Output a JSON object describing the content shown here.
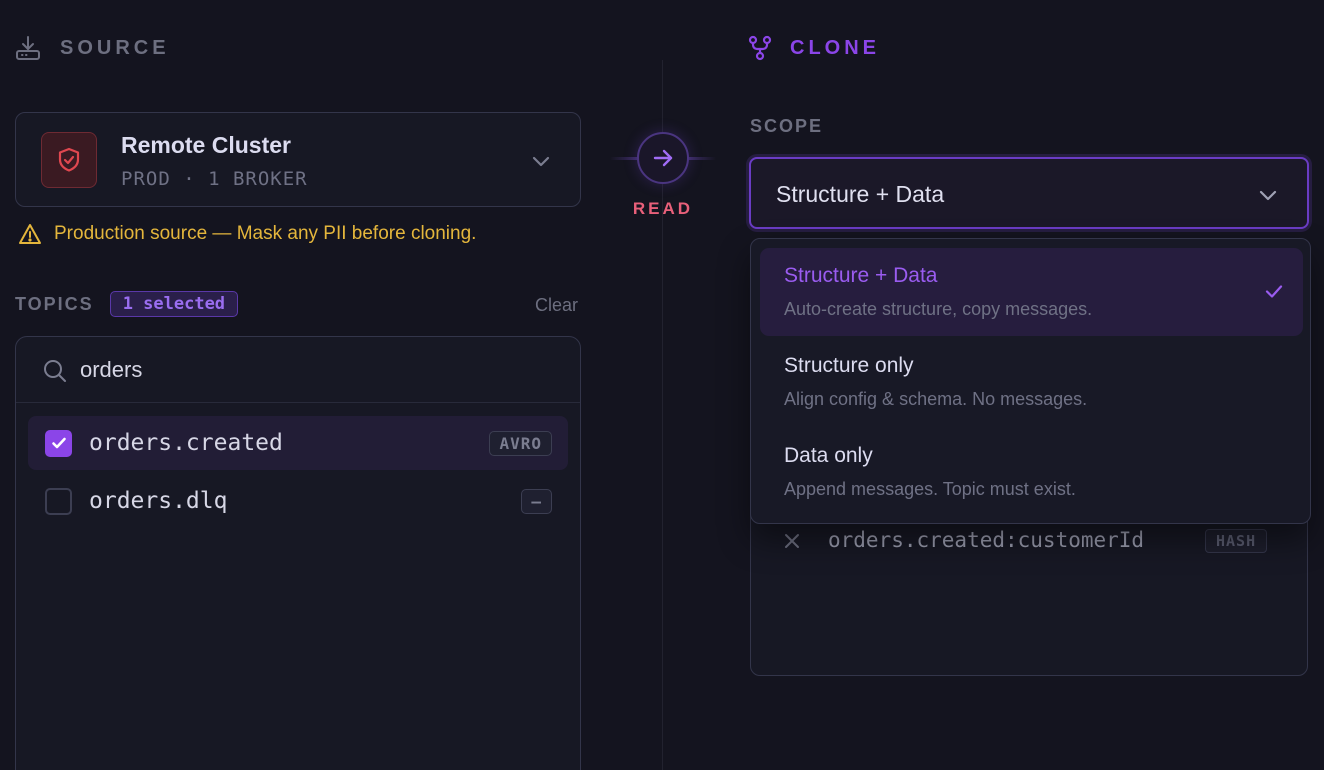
{
  "source": {
    "heading": "SOURCE",
    "icon": "download-tray-icon",
    "cluster": {
      "name": "Remote Cluster",
      "meta": "PROD · 1 BROKER",
      "icon": "shield-check-icon"
    },
    "warning": "Production source — Mask any PII before cloning.",
    "topics": {
      "heading": "TOPICS",
      "selected_badge": "1 selected",
      "clear_label": "Clear",
      "search_value": "orders",
      "items": [
        {
          "name": "orders.created",
          "tag": "AVRO",
          "checked": true
        },
        {
          "name": "orders.dlq",
          "tag": "—",
          "checked": false
        }
      ]
    }
  },
  "connector": {
    "label": "READ",
    "icon": "arrow-right-icon"
  },
  "clone": {
    "heading": "CLONE",
    "icon": "branch-icon",
    "scope": {
      "label": "SCOPE",
      "selected": "Structure + Data",
      "options": [
        {
          "title": "Structure + Data",
          "desc": "Auto-create structure, copy messages.",
          "active": true
        },
        {
          "title": "Structure only",
          "desc": "Align config & schema. No messages.",
          "active": false
        },
        {
          "title": "Data only",
          "desc": "Append messages. Topic must exist.",
          "active": false
        }
      ]
    },
    "masking": {
      "rules": [
        {
          "field": "orders.created:customerId",
          "method": "HASH"
        }
      ]
    }
  },
  "colors": {
    "background": "#14141f",
    "accent": "#8b45e8",
    "warning": "#e4b63c",
    "danger": "#e8607a"
  }
}
